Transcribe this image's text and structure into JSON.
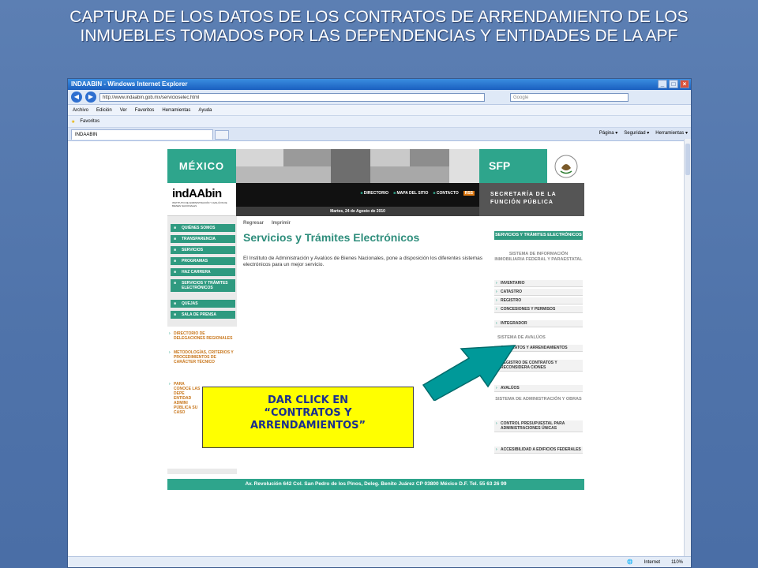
{
  "slide": {
    "title": "CAPTURA DE LOS DATOS DE LOS CONTRATOS DE ARRENDAMIENTO DE LOS INMUEBLES TOMADOS POR LAS DEPENDENCIAS Y ENTIDADES DE LA APF"
  },
  "browser": {
    "window_title": "INDAABIN - Windows Internet Explorer",
    "address": "http://www.indaabin.gob.mx/servicioselec.html",
    "search_placeholder": "Google",
    "menu": [
      "Archivo",
      "Edición",
      "Ver",
      "Favoritos",
      "Herramientas",
      "Ayuda"
    ],
    "favorites_label": "Favoritos",
    "tab_label": "INDAABIN",
    "commands": [
      "Página ▾",
      "Seguridad ▾",
      "Herramientas ▾"
    ],
    "status_zone": "Internet",
    "zoom": "110%"
  },
  "site": {
    "brand_mexico": "MÉXICO",
    "brand_sfp": "SFP",
    "logo": "indAAbin",
    "logo_sub": "INSTITUTO DE ADMINISTRACIÓN Y AVALÚOS DE BIENES NACIONALES",
    "top_links": [
      "DIRECTORIO",
      "MAPA DEL SITIO",
      "CONTACTO"
    ],
    "rss": "RSS",
    "date": "Martes, 24 de Agosto de 2010",
    "sfp_line1": "SECRETARÍA DE LA",
    "sfp_line2": "FUNCIÓN PÚBLICA",
    "left_menu": [
      "QUIÉNES SOMOS",
      "TRANSPARENCIA",
      "SERVICIOS",
      "PROGRAMAS",
      "HAZ CARRERA",
      "SERVICIOS Y TRÁMITES ELECTRÓNICOS",
      "QUEJAS",
      "SALA DE PRENSA"
    ],
    "left_links": [
      "DIRECTORIO DE DELEGACIONES REGIONALES",
      "METODOLOGÍAS, CRITERIOS Y PROCEDIMIENTOS DE CARÁCTER TÉCNICO",
      "PARA CONOCE LAS DEPE ENTIDAD ADMINI PÚBLICA SU CASO"
    ],
    "back_link": "Regresar",
    "print_link": "Imprimir",
    "page_title": "Servicios y Trámites Electrónicos",
    "intro": "El Instituto de Administración y Avalúos de Bienes Nacionales, pone a disposición los diferentes sistemas electrónicos para un mejor servicio.",
    "right_head": "SERVICIOS Y TRÁMITES ELECTRÓNICOS",
    "section1": "SISTEMA DE INFORMACIÓN INMOBILIARIA FEDERAL Y PARAESTATAL",
    "section1_items": [
      "INVENTARIO",
      "CATASTRO",
      "REGISTRO",
      "CONCESIONES Y PERMISOS",
      "INTEGRADOR"
    ],
    "section2": "SISTEMA DE AVALÚOS",
    "section2_items": [
      "CONTRATOS Y ARRENDAMIENTOS",
      "REGISTRO DE CONTRATOS Y RECONSIDERA CIONES",
      "AVALÚOS"
    ],
    "section3": "SISTEMA DE ADMINISTRACIÓN Y OBRAS",
    "section3_items": [
      "CONTROL PRESUPUESTAL PARA ADMINISTRACIONES ÚNICAS",
      "ACCESIBILIDAD A EDIFICIOS FEDERALES"
    ],
    "footer": "Av. Revolución 642 Col. San Pedro de los Pinos, Deleg. Benito Juárez CP 03800 México D.F. Tel. 55 63 26 99"
  },
  "callout": {
    "line1": "DAR CLICK EN",
    "line2": "“CONTRATOS Y",
    "line3": "ARRENDAMIENTOS”"
  },
  "colors": {
    "slide_bg": "#5c7fb3",
    "brand_green": "#2ea58c",
    "callout_bg": "#ffff00",
    "arrow": "#009999"
  }
}
